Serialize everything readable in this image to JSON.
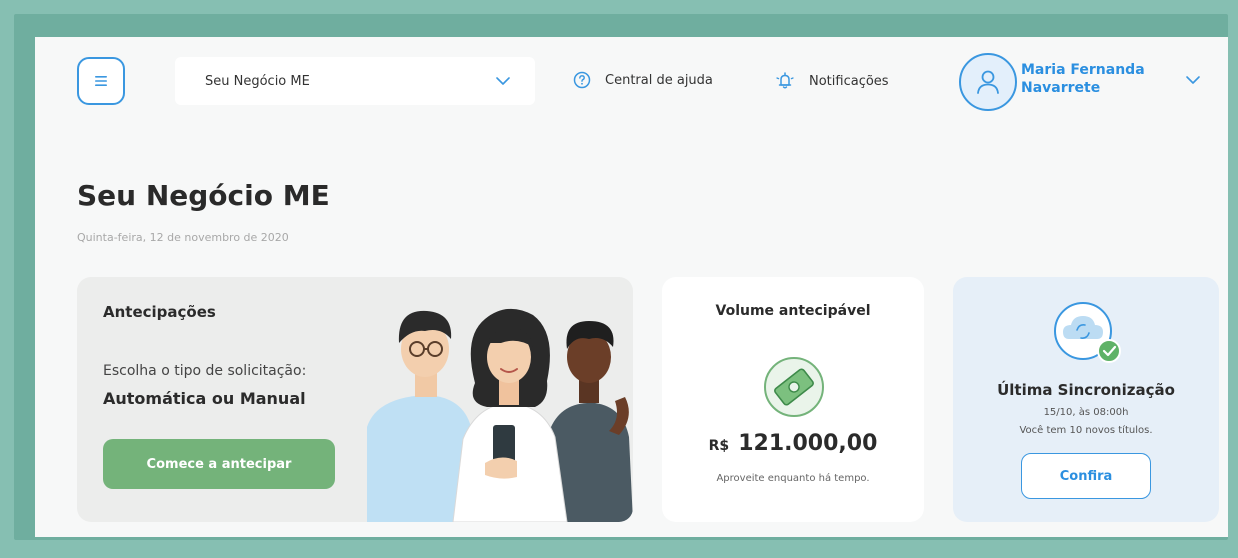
{
  "header": {
    "business_select": {
      "value": "Seu Negócio ME"
    },
    "help_label": "Central de ajuda",
    "notifications_label": "Notificações",
    "user": {
      "name": "Maria Fernanda Navarrete"
    }
  },
  "page": {
    "title": "Seu Negócio ME",
    "date": "Quinta-feira, 12 de novembro de 2020"
  },
  "cards": {
    "antecipacoes": {
      "title": "Antecipações",
      "subtitle": "Escolha o tipo de solicitação:",
      "strong": "Automática ou Manual",
      "button": "Comece a antecipar"
    },
    "volume": {
      "title": "Volume antecipável",
      "currency": "R$",
      "amount": "121.000,00",
      "note": "Aproveite enquanto há tempo."
    },
    "sync": {
      "title": "Última Sincronização",
      "time": "15/10, às 08:00h",
      "new_items": "Você tem 10 novos títulos.",
      "button": "Confira"
    }
  },
  "colors": {
    "accent_blue": "#3a97e0",
    "accent_green": "#74b37a",
    "frame_green": "#86bfb2"
  },
  "icons": [
    "menu-icon",
    "chevron-down-icon",
    "help-icon",
    "bell-icon",
    "user-icon",
    "money-icon",
    "cloud-sync-icon",
    "check-icon"
  ]
}
